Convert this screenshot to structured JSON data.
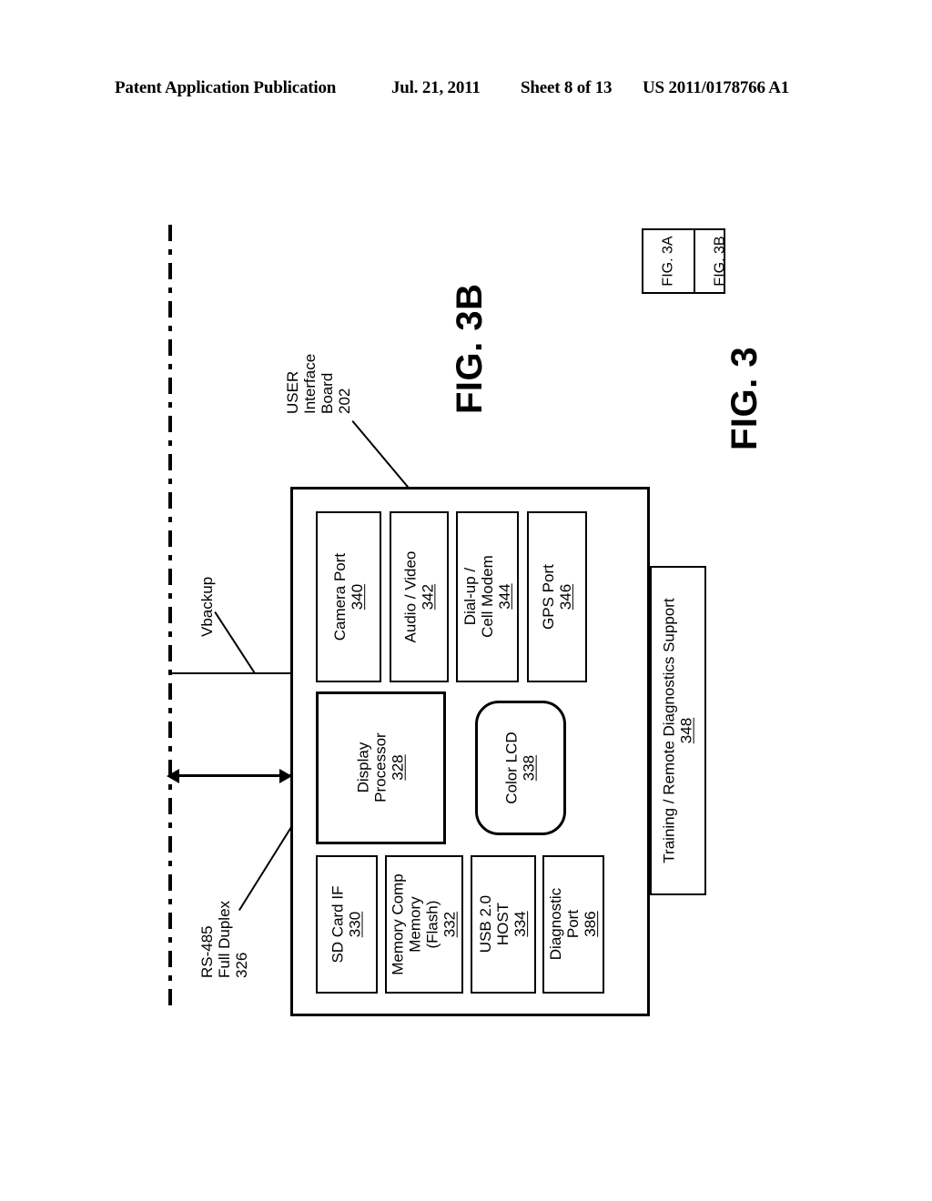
{
  "header": {
    "publication": "Patent Application Publication",
    "date": "Jul. 21, 2011",
    "sheet": "Sheet 8 of 13",
    "patent_number": "US 2011/0178766 A1"
  },
  "figure": {
    "title": "FIG. 3B",
    "sheet_title": "FIG. 3",
    "key": {
      "cells": [
        {
          "label": "FIG. 3A"
        },
        {
          "label": "FIG. 3B"
        }
      ]
    }
  },
  "board": {
    "callout_lines": [
      "USER",
      "Interface",
      "Board"
    ],
    "callout_number": "202"
  },
  "signals": [
    {
      "name": "vbackup",
      "lines": [
        "Vbackup"
      ],
      "number": "",
      "arrow": "none"
    },
    {
      "name": "rs485",
      "lines": [
        "RS-485",
        "Full Duplex"
      ],
      "number": "326",
      "arrow": "double"
    }
  ],
  "components": {
    "top_row": [
      {
        "name": "camera-port",
        "lines": [
          "Camera Port"
        ],
        "number": "340"
      },
      {
        "name": "audio-video",
        "lines": [
          "Audio / Video"
        ],
        "number": "342"
      },
      {
        "name": "dialup-modem",
        "lines": [
          "Dial-up /",
          "Cell Modem"
        ],
        "number": "344"
      },
      {
        "name": "gps-port",
        "lines": [
          "GPS Port"
        ],
        "number": "346"
      }
    ],
    "middle_row": [
      {
        "name": "display-processor",
        "lines": [
          "Display",
          "Processor"
        ],
        "number": "328",
        "shape": "rect"
      },
      {
        "name": "color-lcd",
        "lines": [
          "Color LCD"
        ],
        "number": "338",
        "shape": "rounded"
      }
    ],
    "bottom_row": [
      {
        "name": "sd-card-if",
        "lines": [
          "SD Card IF"
        ],
        "number": "330"
      },
      {
        "name": "flash-memory",
        "lines": [
          "Memory Comp",
          "Memory",
          "(Flash)"
        ],
        "number": "332"
      },
      {
        "name": "usb-host",
        "lines": [
          "USB 2.0",
          "HOST"
        ],
        "number": "334"
      },
      {
        "name": "diagnostic-port",
        "lines": [
          "Diagnostic",
          "Port"
        ],
        "number": "386"
      }
    ],
    "external": [
      {
        "name": "training-remote-diagnostics",
        "lines": [
          "Training / Remote Diagnostics Support"
        ],
        "number": "348"
      }
    ]
  },
  "colors": {
    "ink": "#000000",
    "paper": "#ffffff"
  }
}
